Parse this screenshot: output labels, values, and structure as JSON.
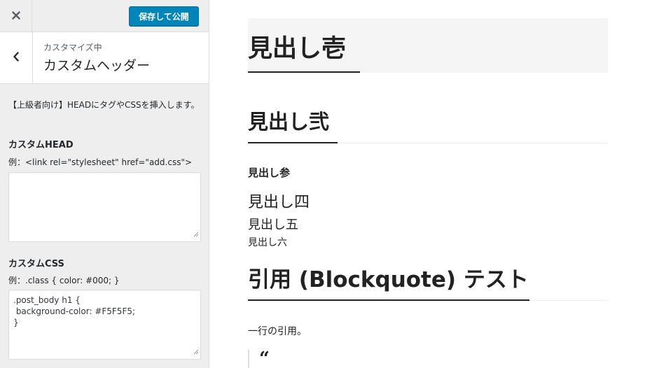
{
  "customizer": {
    "close_icon": "close-icon",
    "save_label": "保存して公開",
    "back_icon": "chevron-left-icon",
    "section_sub": "カスタマイズ中",
    "section_title": "カスタムヘッダー",
    "description": "【上級者向け】HEADにタグやCSSを挿入します。",
    "head_field": {
      "label": "カスタムHEAD",
      "example": "例：<link rel=\"stylesheet\" href=\"add.css\">",
      "value": ""
    },
    "css_field": {
      "label": "カスタムCSS",
      "example": "例：.class { color: #000; }",
      "value": ".post_body h1 {\n background-color: #F5F5F5;\n}"
    },
    "colors": {
      "accent": "#0085ba",
      "panel_bg": "#eeeeee"
    }
  },
  "preview": {
    "h1": "見出し壱",
    "h2": "見出し弐",
    "h3": "見出し参",
    "h4": "見出し四",
    "h5": "見出し五",
    "h6": "見出し六",
    "blockquote_heading": "引用 (Blockquote) テスト",
    "paragraph": "一行の引用。",
    "quote_mark": "“",
    "colors": {
      "h1_bg": "#F5F5F5"
    }
  }
}
